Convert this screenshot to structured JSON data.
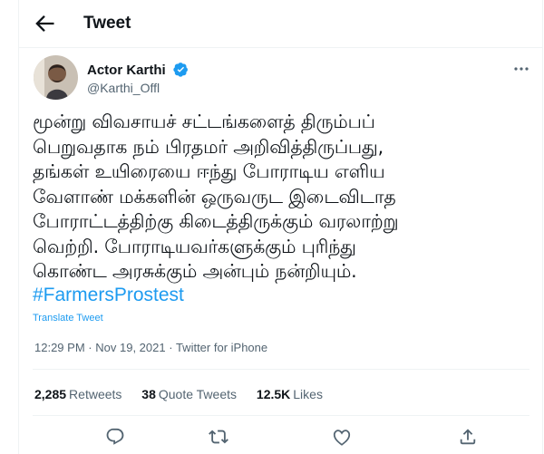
{
  "header": {
    "title": "Tweet"
  },
  "author": {
    "name": "Actor Karthi",
    "handle": "@Karthi_Offl"
  },
  "tweet": {
    "text": "மூன்று விவசாயச் சட்டங்களைத் திரும்பப்\nபெறுவதாக நம் பிரதமர் அறிவித்திருப்பது,\nதங்கள் உயிரையை ஈந்து போராடிய எளிய\nவேளாண் மக்களின் ஒருவருட இடைவிடாத\nபோராட்டத்திற்கு கிடைத்திருக்கும் வரலாற்று\nவெற்றி. போராடியவர்களுக்கும் புரிந்து\nகொண்ட அரசுக்கும் அன்பும் நன்றியும்.",
    "hashtag": "#FarmersProstest",
    "translate": "Translate Tweet",
    "time": "12:29 PM",
    "date": "Nov 19, 2021",
    "client": "Twitter for iPhone",
    "separator": "·"
  },
  "stats": {
    "retweets_count": "2,285",
    "retweets_label": "Retweets",
    "quotes_count": "38",
    "quotes_label": "Quote Tweets",
    "likes_count": "12.5K",
    "likes_label": "Likes"
  },
  "icons": {
    "back": "arrow-left-icon",
    "verified": "verified-badge-icon",
    "more": "more-horizontal-icon",
    "reply": "reply-icon",
    "retweet": "retweet-icon",
    "like": "heart-icon",
    "share": "share-icon"
  },
  "colors": {
    "accent": "#1d9bf0",
    "text": "#0f1419",
    "muted": "#536471",
    "border": "#eff3f4"
  }
}
